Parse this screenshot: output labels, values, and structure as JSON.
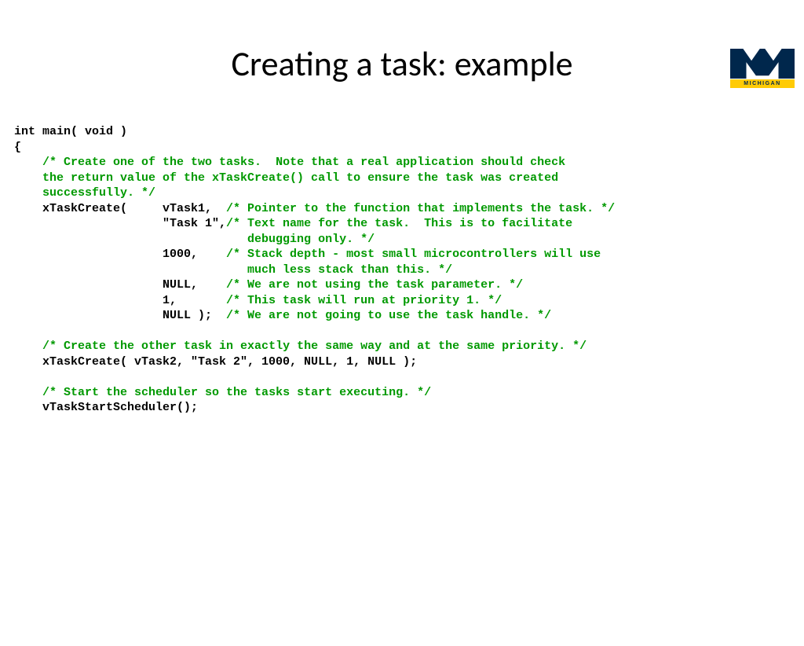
{
  "title": "Creating a task: example",
  "logo_text": "MICHIGAN",
  "code": {
    "l1": "int main( void )",
    "l2": "{",
    "l3a": "    ",
    "l3b": "/* Create one of the two tasks.  Note that a real application should check",
    "l4": "    the return value of the xTaskCreate() call to ensure the task was created",
    "l5": "    successfully. */",
    "l6a": "    xTaskCreate(     vTask1,  ",
    "l6b": "/* Pointer to the function that implements the task. */",
    "l7a": "                     \"Task 1\",",
    "l7b": "/* Text name for the task.  This is to facilitate",
    "l8": "                                 debugging only. */",
    "l9a": "                     1000,    ",
    "l9b": "/* Stack depth - most small microcontrollers will use",
    "l10": "                                 much less stack than this. */",
    "l11a": "                     NULL,    ",
    "l11b": "/* We are not using the task parameter. */",
    "l12a": "                     1,       ",
    "l12b": "/* This task will run at priority 1. */",
    "l13a": "                     NULL );  ",
    "l13b": "/* We are not going to use the task handle. */",
    "blank1": "",
    "l14a": "    ",
    "l14b": "/* Create the other task in exactly the same way and at the same priority. */",
    "l15": "    xTaskCreate( vTask2, \"Task 2\", 1000, NULL, 1, NULL );",
    "blank2": "",
    "l16a": "    ",
    "l16b": "/* Start the scheduler so the tasks start executing. */",
    "l17": "    vTaskStartScheduler();"
  }
}
